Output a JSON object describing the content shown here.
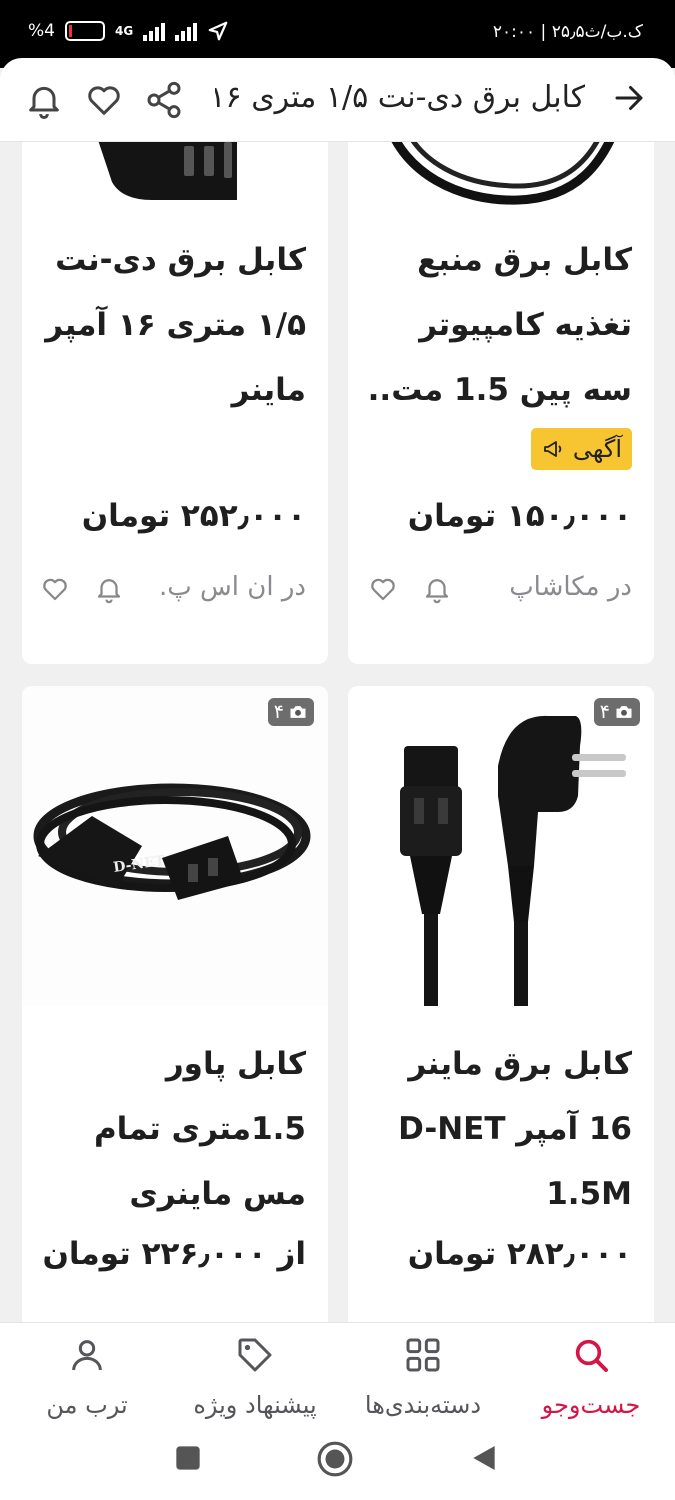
{
  "status_bar": {
    "battery": "%4",
    "network": "4G",
    "time_text": "۲۰:۰۰ | ۲۵٫۵ک.ب/ث"
  },
  "header": {
    "title": "کابل برق دی-نت ۱/۵ متری ۱۶ آمپر ماینر"
  },
  "products": [
    {
      "title": "کابل برق منبع تغذیه کامپیوتر سه پین 1.5 مت..",
      "badge": "آگهی",
      "price": "۱۵۰٫۰۰۰ تومان",
      "seller": "در مکاشاپ"
    },
    {
      "title": "کابل برق دی-نت ۱/۵ متری ۱۶ آمپر ماینر",
      "price": "۲۵۲٫۰۰۰ تومان",
      "seller": "در ان اس پ."
    },
    {
      "title": "کابل برق ماینر 16 آمپر D-NET 1.5M",
      "photo_count": "۴",
      "price": "۲۸۲٫۰۰۰ تومان"
    },
    {
      "title": "کابل پاور 1.5متری تمام مس ماینری",
      "photo_count": "۴",
      "price": "از ۲۲۶٫۰۰۰ تومان",
      "image_text": "D-NET"
    }
  ],
  "bottom_nav": {
    "items": [
      {
        "label": "جست‌وجو",
        "icon": "search-icon",
        "active": true
      },
      {
        "label": "دسته‌بندی‌ها",
        "icon": "grid-icon",
        "active": false
      },
      {
        "label": "پیشنهاد ویژه",
        "icon": "tag-icon",
        "active": false
      },
      {
        "label": "ترب من",
        "icon": "user-icon",
        "active": false
      }
    ]
  },
  "colors": {
    "accent": "#d31547",
    "ad_badge": "#f6c531",
    "background": "#f0f0f1"
  }
}
